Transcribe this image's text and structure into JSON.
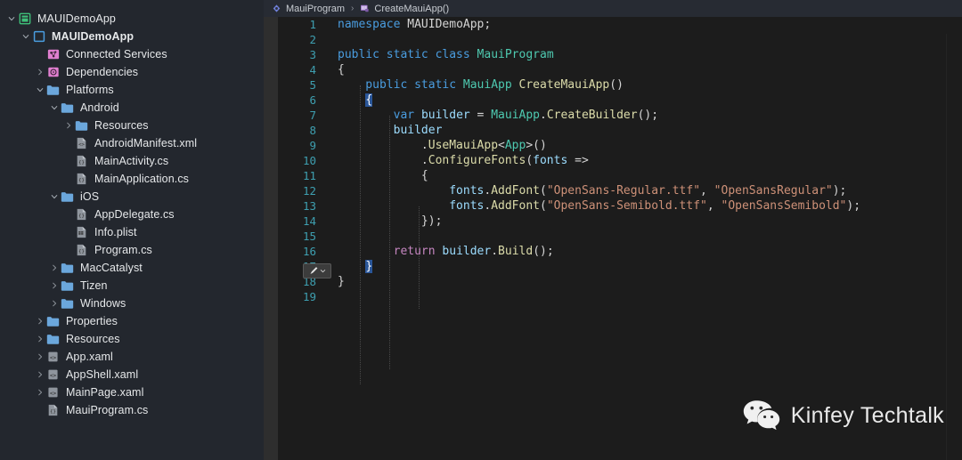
{
  "sidebar": {
    "name": "solution-explorer",
    "items": [
      {
        "label": "MAUIDemoApp",
        "depth": 0,
        "chevron": "down",
        "icon": "solution-icon",
        "bold": false
      },
      {
        "label": "MAUIDemoApp",
        "depth": 1,
        "chevron": "down",
        "icon": "project-icon",
        "bold": true
      },
      {
        "label": "Connected Services",
        "depth": 2,
        "chevron": "none",
        "icon": "connected-services-icon",
        "bold": false
      },
      {
        "label": "Dependencies",
        "depth": 2,
        "chevron": "right",
        "icon": "dependencies-icon",
        "bold": false
      },
      {
        "label": "Platforms",
        "depth": 2,
        "chevron": "down",
        "icon": "folder-icon",
        "bold": false
      },
      {
        "label": "Android",
        "depth": 3,
        "chevron": "down",
        "icon": "folder-icon",
        "bold": false
      },
      {
        "label": "Resources",
        "depth": 4,
        "chevron": "right",
        "icon": "folder-icon",
        "bold": false
      },
      {
        "label": "AndroidManifest.xml",
        "depth": 4,
        "chevron": "none",
        "icon": "xml-file-icon",
        "bold": false
      },
      {
        "label": "MainActivity.cs",
        "depth": 4,
        "chevron": "none",
        "icon": "csharp-file-icon",
        "bold": false
      },
      {
        "label": "MainApplication.cs",
        "depth": 4,
        "chevron": "none",
        "icon": "csharp-file-icon",
        "bold": false
      },
      {
        "label": "iOS",
        "depth": 3,
        "chevron": "down",
        "icon": "folder-icon",
        "bold": false
      },
      {
        "label": "AppDelegate.cs",
        "depth": 4,
        "chevron": "none",
        "icon": "csharp-file-icon",
        "bold": false
      },
      {
        "label": "Info.plist",
        "depth": 4,
        "chevron": "none",
        "icon": "plist-file-icon",
        "bold": false
      },
      {
        "label": "Program.cs",
        "depth": 4,
        "chevron": "none",
        "icon": "csharp-file-icon",
        "bold": false
      },
      {
        "label": "MacCatalyst",
        "depth": 3,
        "chevron": "right",
        "icon": "folder-icon",
        "bold": false
      },
      {
        "label": "Tizen",
        "depth": 3,
        "chevron": "right",
        "icon": "folder-icon",
        "bold": false
      },
      {
        "label": "Windows",
        "depth": 3,
        "chevron": "right",
        "icon": "folder-icon",
        "bold": false
      },
      {
        "label": "Properties",
        "depth": 2,
        "chevron": "right",
        "icon": "folder-icon",
        "bold": false
      },
      {
        "label": "Resources",
        "depth": 2,
        "chevron": "right",
        "icon": "folder-icon",
        "bold": false
      },
      {
        "label": "App.xaml",
        "depth": 2,
        "chevron": "right",
        "icon": "xaml-file-icon",
        "bold": false
      },
      {
        "label": "AppShell.xaml",
        "depth": 2,
        "chevron": "right",
        "icon": "xaml-file-icon",
        "bold": false
      },
      {
        "label": "MainPage.xaml",
        "depth": 2,
        "chevron": "right",
        "icon": "xaml-file-icon",
        "bold": false
      },
      {
        "label": "MauiProgram.cs",
        "depth": 2,
        "chevron": "none",
        "icon": "csharp-file-icon",
        "bold": false
      }
    ]
  },
  "breadcrumb": {
    "class_icon": "class-icon",
    "class_name": "MauiProgram",
    "separator": "›",
    "method_icon": "method-icon",
    "method_name": "CreateMauiApp()"
  },
  "editor": {
    "quick_action_label": "quick-actions",
    "lines": [
      {
        "n": "1",
        "tokens": [
          {
            "t": "namespace ",
            "c": "kw"
          },
          {
            "t": "MAUIDemoApp;",
            "c": "pl"
          }
        ]
      },
      {
        "n": "2",
        "tokens": []
      },
      {
        "n": "3",
        "tokens": [
          {
            "t": "public static class ",
            "c": "kw"
          },
          {
            "t": "MauiProgram",
            "c": "typ"
          }
        ]
      },
      {
        "n": "4",
        "tokens": [
          {
            "t": "{",
            "c": "brc"
          }
        ]
      },
      {
        "n": "5",
        "tokens": [
          {
            "t": "    public static ",
            "c": "kw"
          },
          {
            "t": "MauiApp",
            "c": "typ"
          },
          {
            "t": " ",
            "c": "pl"
          },
          {
            "t": "CreateMauiApp",
            "c": "mth"
          },
          {
            "t": "()",
            "c": "pl"
          }
        ]
      },
      {
        "n": "6",
        "tokens": [
          {
            "t": "    ",
            "c": "pl"
          },
          {
            "t": "{",
            "c": "match"
          }
        ]
      },
      {
        "n": "7",
        "tokens": [
          {
            "t": "        ",
            "c": "pl"
          },
          {
            "t": "var",
            "c": "kw"
          },
          {
            "t": " ",
            "c": "pl"
          },
          {
            "t": "builder",
            "c": "id"
          },
          {
            "t": " = ",
            "c": "pl"
          },
          {
            "t": "MauiApp",
            "c": "typ"
          },
          {
            "t": ".",
            "c": "pl"
          },
          {
            "t": "CreateBuilder",
            "c": "mth"
          },
          {
            "t": "();",
            "c": "pl"
          }
        ]
      },
      {
        "n": "8",
        "tokens": [
          {
            "t": "        ",
            "c": "pl"
          },
          {
            "t": "builder",
            "c": "id"
          }
        ]
      },
      {
        "n": "9",
        "tokens": [
          {
            "t": "            .",
            "c": "pl"
          },
          {
            "t": "UseMauiApp",
            "c": "mth"
          },
          {
            "t": "<",
            "c": "pl"
          },
          {
            "t": "App",
            "c": "typ"
          },
          {
            "t": ">()",
            "c": "pl"
          }
        ]
      },
      {
        "n": "10",
        "tokens": [
          {
            "t": "            .",
            "c": "pl"
          },
          {
            "t": "ConfigureFonts",
            "c": "mth"
          },
          {
            "t": "(",
            "c": "pl"
          },
          {
            "t": "fonts",
            "c": "id"
          },
          {
            "t": " =>",
            "c": "pl"
          }
        ]
      },
      {
        "n": "11",
        "tokens": [
          {
            "t": "            {",
            "c": "brc"
          }
        ]
      },
      {
        "n": "12",
        "tokens": [
          {
            "t": "                ",
            "c": "pl"
          },
          {
            "t": "fonts",
            "c": "id"
          },
          {
            "t": ".",
            "c": "pl"
          },
          {
            "t": "AddFont",
            "c": "mth"
          },
          {
            "t": "(",
            "c": "pl"
          },
          {
            "t": "\"OpenSans-Regular.ttf\"",
            "c": "str"
          },
          {
            "t": ", ",
            "c": "pl"
          },
          {
            "t": "\"OpenSansRegular\"",
            "c": "str"
          },
          {
            "t": ");",
            "c": "pl"
          }
        ]
      },
      {
        "n": "13",
        "tokens": [
          {
            "t": "                ",
            "c": "pl"
          },
          {
            "t": "fonts",
            "c": "id"
          },
          {
            "t": ".",
            "c": "pl"
          },
          {
            "t": "AddFont",
            "c": "mth"
          },
          {
            "t": "(",
            "c": "pl"
          },
          {
            "t": "\"OpenSans-Semibold.ttf\"",
            "c": "str"
          },
          {
            "t": ", ",
            "c": "pl"
          },
          {
            "t": "\"OpenSansSemibold\"",
            "c": "str"
          },
          {
            "t": ");",
            "c": "pl"
          }
        ]
      },
      {
        "n": "14",
        "tokens": [
          {
            "t": "            });",
            "c": "pl"
          }
        ]
      },
      {
        "n": "15",
        "tokens": []
      },
      {
        "n": "16",
        "tokens": [
          {
            "t": "        ",
            "c": "pl"
          },
          {
            "t": "return",
            "c": "kw2"
          },
          {
            "t": " ",
            "c": "pl"
          },
          {
            "t": "builder",
            "c": "id"
          },
          {
            "t": ".",
            "c": "pl"
          },
          {
            "t": "Build",
            "c": "mth"
          },
          {
            "t": "();",
            "c": "pl"
          }
        ]
      },
      {
        "n": "17",
        "tokens": [
          {
            "t": "    ",
            "c": "pl"
          },
          {
            "t": "}",
            "c": "match"
          }
        ]
      },
      {
        "n": "18",
        "tokens": [
          {
            "t": "}",
            "c": "brc"
          }
        ]
      },
      {
        "n": "19",
        "tokens": []
      }
    ]
  },
  "watermark": {
    "icon": "wechat-icon",
    "text": "Kinfey Techtalk"
  },
  "colors": {
    "sidebar_bg": "#23272e",
    "editor_bg": "#1c1c1c",
    "breadcrumb_bg": "#272b33",
    "line_number": "#3e9fb0",
    "keyword": "#4a9de0",
    "type": "#4ec9b0",
    "method": "#dcdcaa",
    "string": "#ce9178",
    "identifier": "#9cdcfe",
    "folder": "#6ba7dc",
    "solution": "#3fbf79",
    "dependency": "#d israel"
  }
}
